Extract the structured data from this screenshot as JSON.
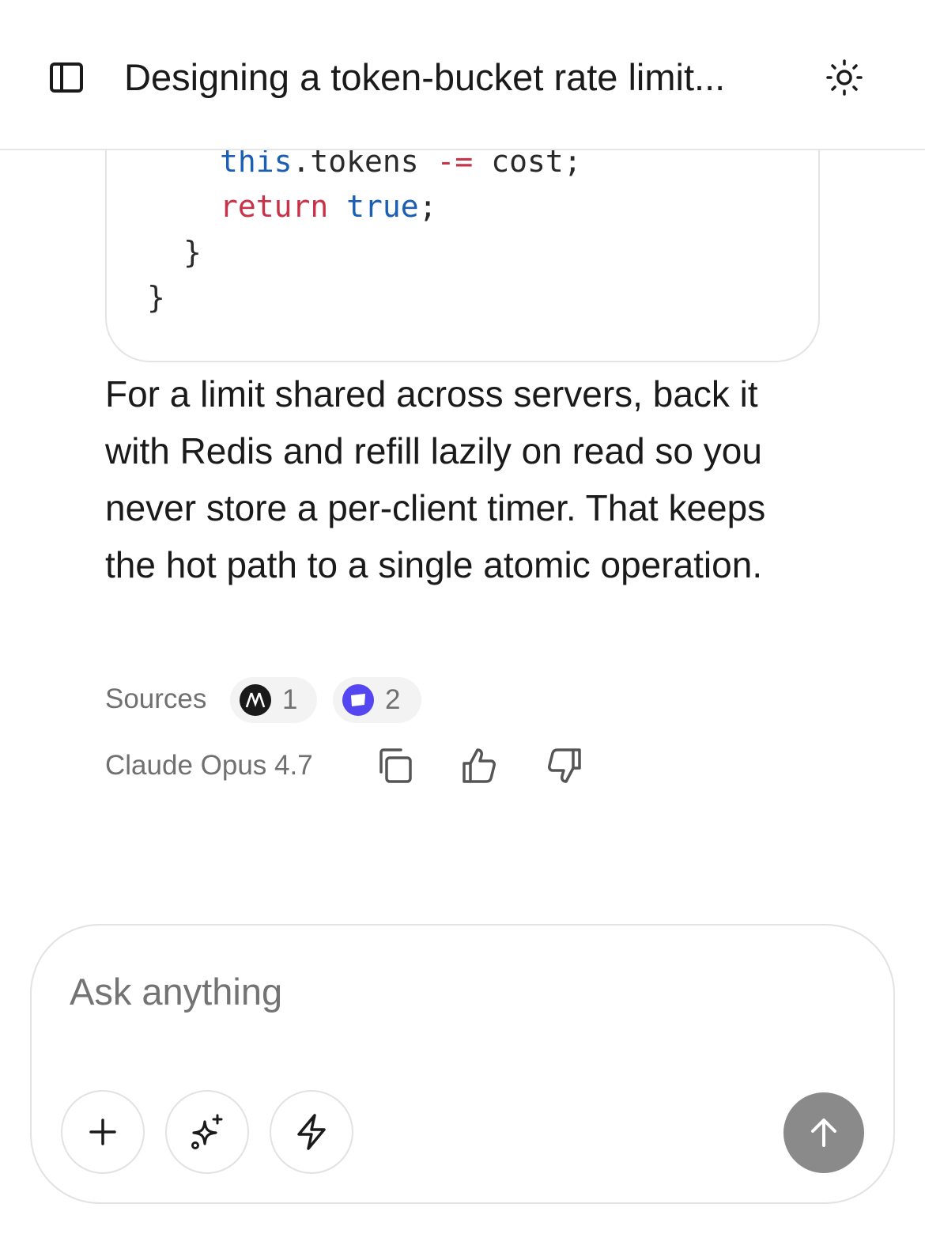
{
  "header": {
    "title": "Designing a token-bucket rate limit...",
    "sidebar_icon": "sidebar-toggle-icon",
    "theme_icon": "sun-icon"
  },
  "code_block": {
    "lines": [
      {
        "tokens": [
          {
            "text": "this",
            "cls": "kw-blue"
          },
          {
            "text": ".tokens ",
            "cls": "tok-plain"
          },
          {
            "text": "-=",
            "cls": "kw-red"
          },
          {
            "text": " cost;",
            "cls": "tok-plain"
          }
        ]
      },
      {
        "tokens": [
          {
            "text": "return",
            "cls": "kw-red"
          },
          {
            "text": " ",
            "cls": "tok-plain"
          },
          {
            "text": "true",
            "cls": "kw-blue"
          },
          {
            "text": ";",
            "cls": "tok-plain"
          }
        ]
      },
      {
        "tokens": [
          {
            "text": "}",
            "cls": "tok-plain"
          }
        ]
      },
      {
        "tokens": [
          {
            "text": "}",
            "cls": "tok-plain"
          }
        ]
      }
    ]
  },
  "answer": {
    "text": "For a limit shared across servers, back it with Redis and refill lazily on read so you never store a per-client timer. That keeps the hot path to a single atomic operation."
  },
  "sources": {
    "label": "Sources",
    "chips": [
      {
        "count": "1",
        "icon": "source-m-icon"
      },
      {
        "count": "2",
        "icon": "source-linear-icon"
      }
    ]
  },
  "message_meta": {
    "model": "Claude Opus 4.7",
    "actions": [
      "copy-icon",
      "thumbs-up-icon",
      "thumbs-down-icon"
    ]
  },
  "composer": {
    "placeholder": "Ask anything",
    "value": "",
    "tools": [
      "plus-icon",
      "sparkles-icon",
      "lightning-icon"
    ],
    "send_icon": "arrow-up-icon"
  },
  "colors": {
    "accent_purple": "#5446f0",
    "send_button": "#8a8a8a",
    "keyword_blue": "#1a5fb4",
    "keyword_red": "#c8334a"
  }
}
